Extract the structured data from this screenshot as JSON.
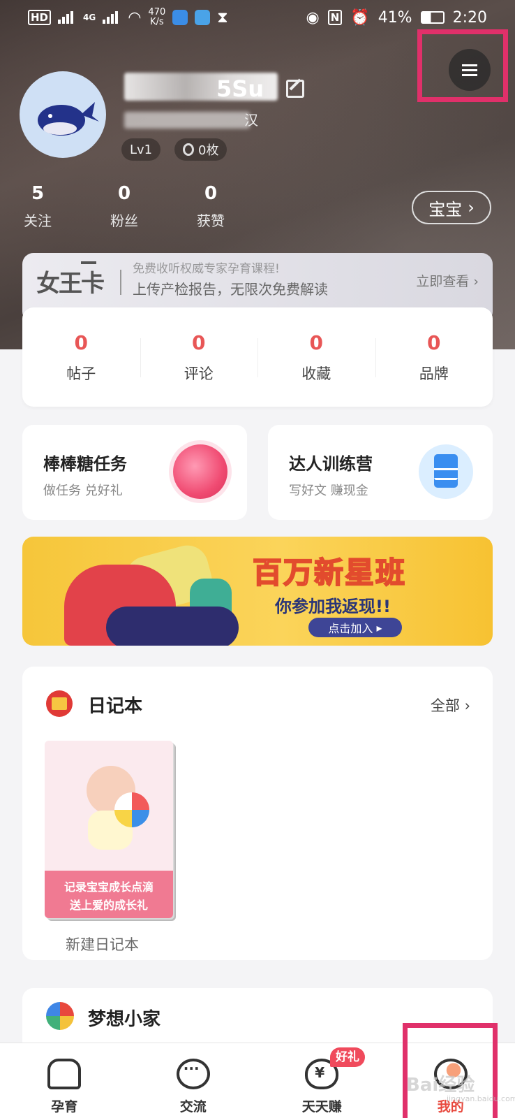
{
  "status_bar": {
    "hd_badge": "HD",
    "signal_label": "4G",
    "net_speed": "470",
    "net_speed_unit": "K/s",
    "nfc": "N",
    "battery": "41%",
    "time": "2:20"
  },
  "profile": {
    "username_visible": "5Su",
    "location_visible": "汉",
    "level": "Lv1",
    "medals": "0枚",
    "stats": [
      {
        "num": "5",
        "label": "关注"
      },
      {
        "num": "0",
        "label": "粉丝"
      },
      {
        "num": "0",
        "label": "获赞"
      }
    ],
    "baby_button": "宝宝"
  },
  "vip_card": {
    "logo": "女王卡",
    "line1": "免费收听权威专家孕育课程!",
    "line2": "上传产检报告，无限次免费解读",
    "cta": "立即查看"
  },
  "counts": [
    {
      "num": "0",
      "label": "帖子"
    },
    {
      "num": "0",
      "label": "评论"
    },
    {
      "num": "0",
      "label": "收藏"
    },
    {
      "num": "0",
      "label": "品牌"
    }
  ],
  "tasks": [
    {
      "title": "棒棒糖任务",
      "subtitle": "做任务 兑好礼",
      "icon": "lollipop-icon"
    },
    {
      "title": "达人训练营",
      "subtitle": "写好文 赚现金",
      "icon": "document-icon"
    }
  ],
  "banner": {
    "title": "百万新星班",
    "subtitle": "你参加我返现!!",
    "button": "点击加入"
  },
  "diary": {
    "title": "日记本",
    "all_label": "全部",
    "book_caption_1": "记录宝宝成长点滴",
    "book_caption_2": "送上爱的成长礼",
    "new_label": "新建日记本"
  },
  "dream_home": {
    "title": "梦想小家"
  },
  "tabbar": [
    {
      "label": "孕育",
      "icon": "home-icon"
    },
    {
      "label": "交流",
      "icon": "chat-icon"
    },
    {
      "label": "天天赚",
      "icon": "money-bag-icon",
      "badge": "好礼"
    },
    {
      "label": "我的",
      "icon": "profile-icon",
      "active": true
    }
  ],
  "watermark": {
    "text": "Bai经验",
    "url": "jingyan.baidu.com"
  },
  "colors": {
    "accent_red": "#e85656",
    "highlight": "#e0306a",
    "banner_yellow": "#f6c63a"
  }
}
